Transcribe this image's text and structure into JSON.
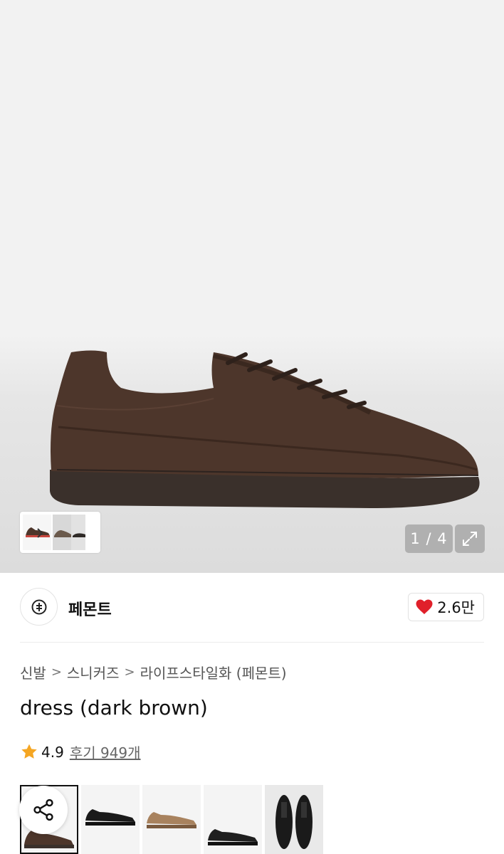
{
  "gallery": {
    "counter": "1 / 4",
    "image_name": "dark-brown-suede-sneaker"
  },
  "brand": {
    "name": "페몬트",
    "logo_icon": "brand-logo-icon",
    "likes": "2.6만",
    "heart_color": "#e0202a"
  },
  "breadcrumb": {
    "items": [
      "신발",
      "스니커즈",
      "라이프스타일화 (페몬트)"
    ],
    "separator": ">"
  },
  "product": {
    "title": "dress (dark brown)",
    "rating": "4.9",
    "reviews": "후기 949개",
    "star_color": "#f5a623"
  },
  "options": [
    {
      "color": "dark brown",
      "selected": true
    },
    {
      "color": "black"
    },
    {
      "color": "tan"
    },
    {
      "color": "black leather"
    },
    {
      "color": "black top view"
    }
  ]
}
